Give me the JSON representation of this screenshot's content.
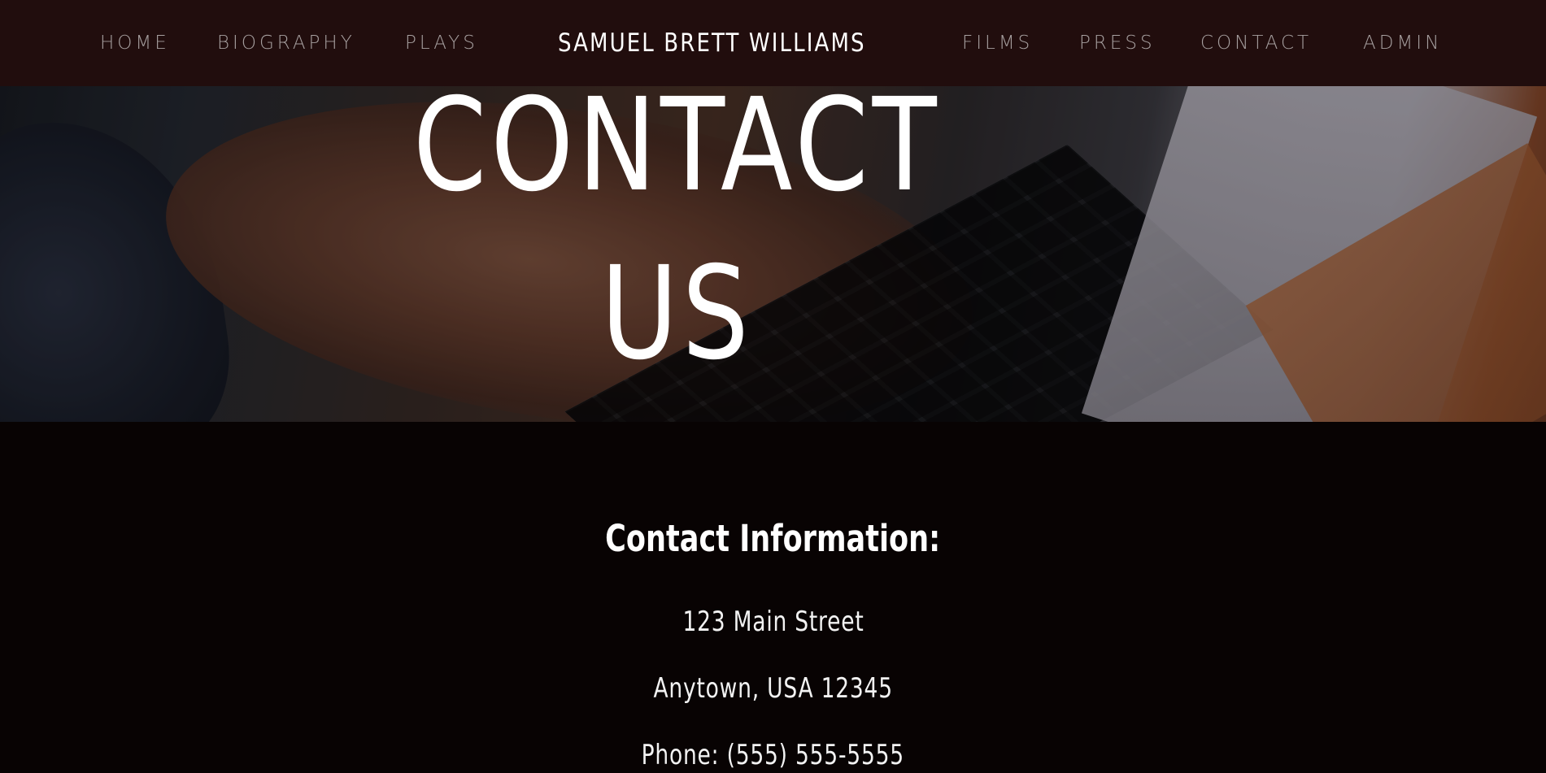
{
  "nav": {
    "left_links": [
      "HOME",
      "BIOGRAPHY",
      "PLAYS"
    ],
    "brand": "SAMUEL BRETT WILLIAMS",
    "right_links": [
      "FILMS",
      "PRESS",
      "CONTACT",
      "ADMIN"
    ]
  },
  "hero": {
    "title_line1": "CONTACT",
    "title_line2": "US"
  },
  "contact": {
    "heading": "Contact Information:",
    "address_line1": "123 Main Street",
    "address_line2": "Anytown, USA 12345",
    "phone": "Phone: (555) 555-5555"
  },
  "colors": {
    "navbar_bg": "#210d0d",
    "page_bg": "#080303",
    "nav_text": "#a69f9f",
    "brand_text": "#ffffff"
  }
}
